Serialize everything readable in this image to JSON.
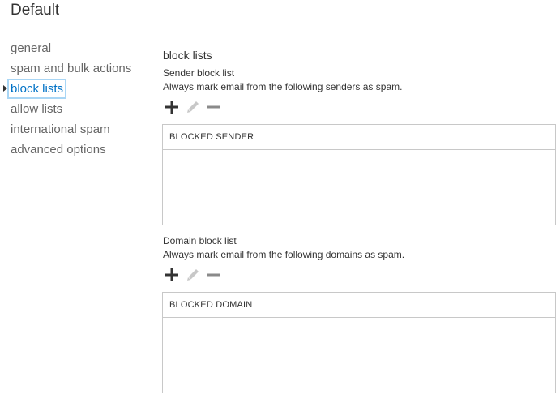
{
  "page": {
    "title": "Default"
  },
  "nav": {
    "items": [
      {
        "label": "general",
        "selected": false
      },
      {
        "label": "spam and bulk actions",
        "selected": false
      },
      {
        "label": "block lists",
        "selected": true
      },
      {
        "label": "allow lists",
        "selected": false
      },
      {
        "label": "international spam",
        "selected": false
      },
      {
        "label": "advanced options",
        "selected": false
      }
    ]
  },
  "main": {
    "heading": "block lists",
    "sender": {
      "title": "Sender block list",
      "description": "Always mark email from the following senders as spam.",
      "column_header": "BLOCKED SENDER"
    },
    "domain": {
      "title": "Domain block list",
      "description": "Always mark email from the following domains as spam.",
      "column_header": "BLOCKED DOMAIN"
    }
  },
  "icons": {
    "add": "plus-icon",
    "edit": "pencil-icon",
    "remove": "minus-icon"
  },
  "colors": {
    "accent": "#0072c6",
    "selection_border": "#a9d6f5",
    "icon_active": "#333333",
    "icon_disabled": "#c8c8c8"
  }
}
